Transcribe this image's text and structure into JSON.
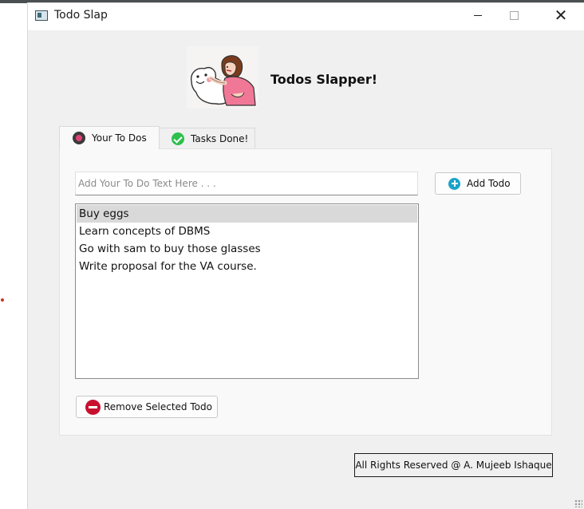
{
  "window": {
    "title": "Todo Slap"
  },
  "header": {
    "logo_icon": "slap-cartoon-logo",
    "heading": "Todos Slapper!"
  },
  "tabs": [
    {
      "label": "Your To Dos",
      "icon": "record-icon",
      "active": true
    },
    {
      "label": "Tasks Done!",
      "icon": "check-circle-icon",
      "active": false
    }
  ],
  "todo": {
    "input_placeholder": "Add Your To Do Text Here . . .",
    "input_value": "",
    "add_button_label": "Add Todo",
    "remove_button_label": "Remove Selected Todo",
    "items": [
      {
        "text": "Buy eggs",
        "selected": true
      },
      {
        "text": "Learn concepts of DBMS",
        "selected": false
      },
      {
        "text": "Go with sam to buy those glasses",
        "selected": false
      },
      {
        "text": "Write proposal for the VA course.",
        "selected": false
      }
    ]
  },
  "footer": {
    "text": "All Rights Reserved @ A. Mujeeb Ishaque"
  },
  "colors": {
    "window_bg": "#f0f0f0",
    "panel_bg": "#f9f9f9",
    "selection": "#d9d9d9",
    "add_icon": "#1aa3c9",
    "remove_icon": "#c8102e",
    "check_icon": "#2ebf4f"
  }
}
